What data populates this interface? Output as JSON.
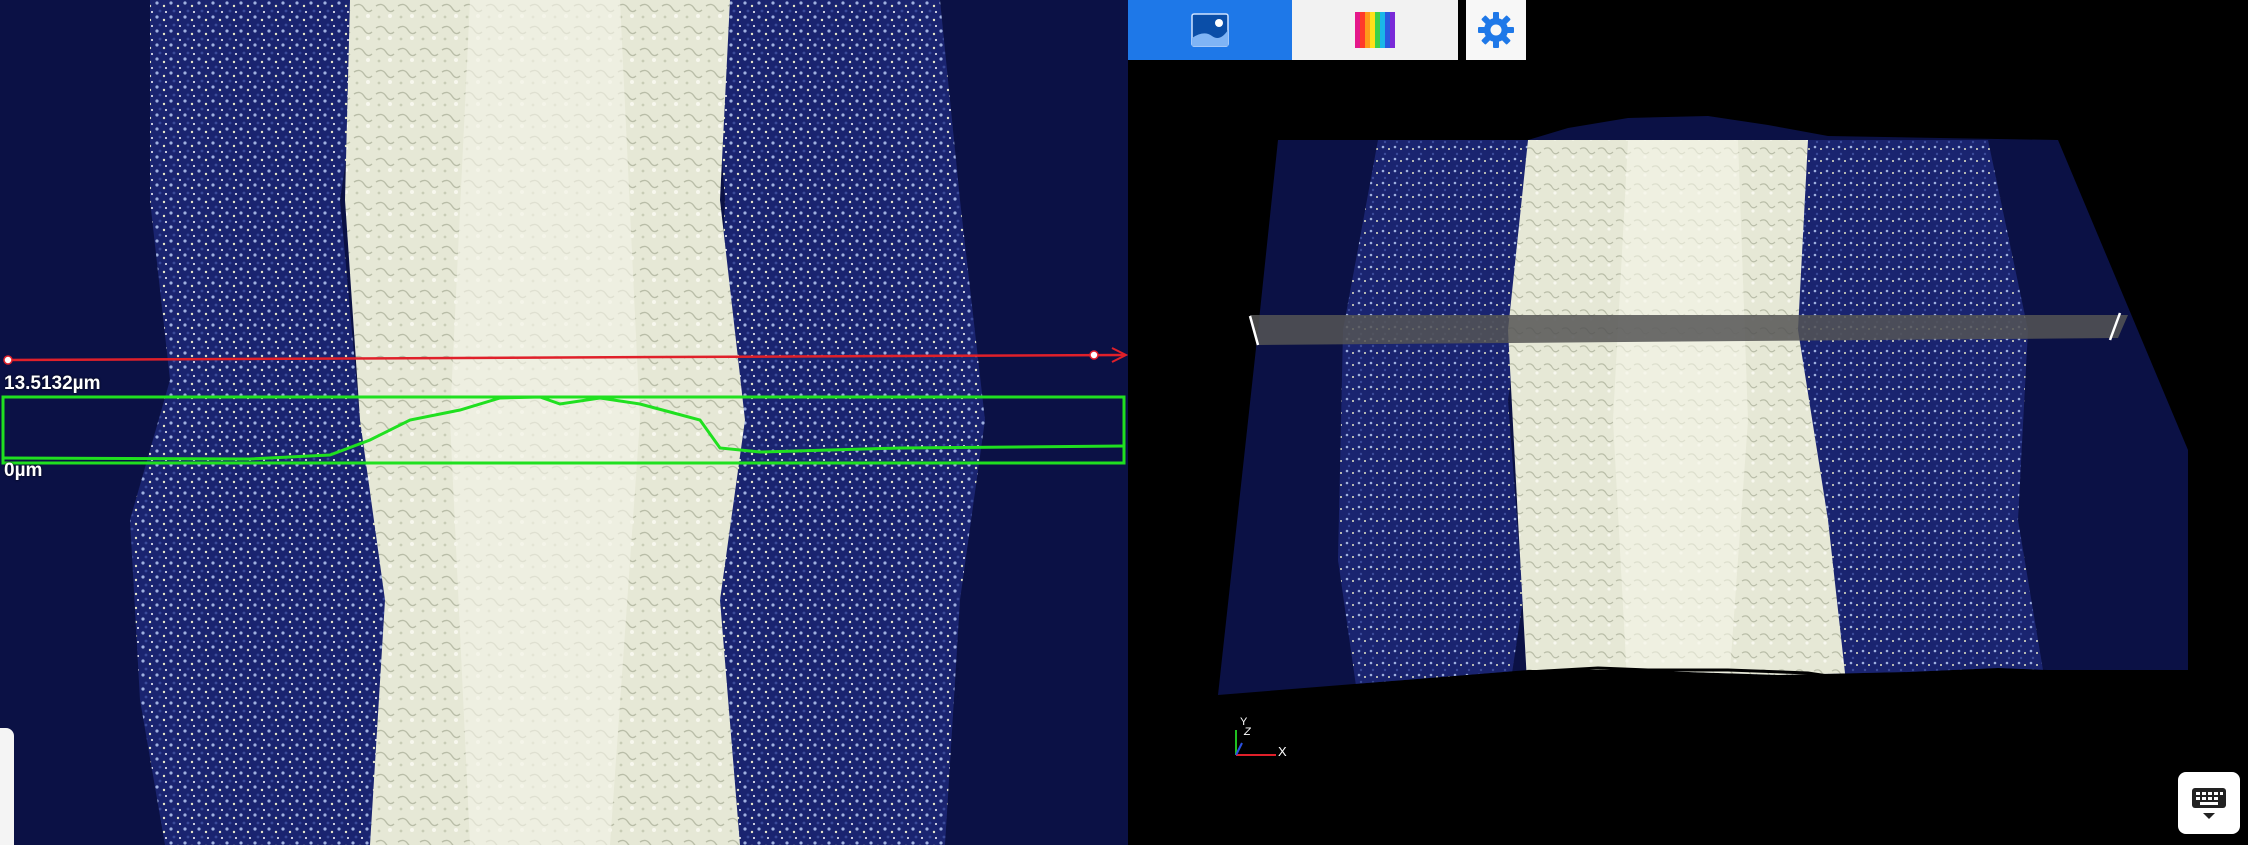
{
  "measurement": {
    "top_label": "13.5132µm",
    "bottom_label": "0µm"
  },
  "toolbar": {
    "image_button": "image-view-icon",
    "colormap_button": "rainbow-colormap-icon",
    "settings_button": "gear-icon"
  },
  "axes": {
    "x_label": "X",
    "y_label": "Y",
    "z_label": "Z"
  },
  "keyboard_button": "keyboard-icon",
  "colors": {
    "line_marker": "#e0202a",
    "profile": "#20e020",
    "toolbar_accent": "#1e78e8",
    "background_dark": "#0b1145"
  }
}
